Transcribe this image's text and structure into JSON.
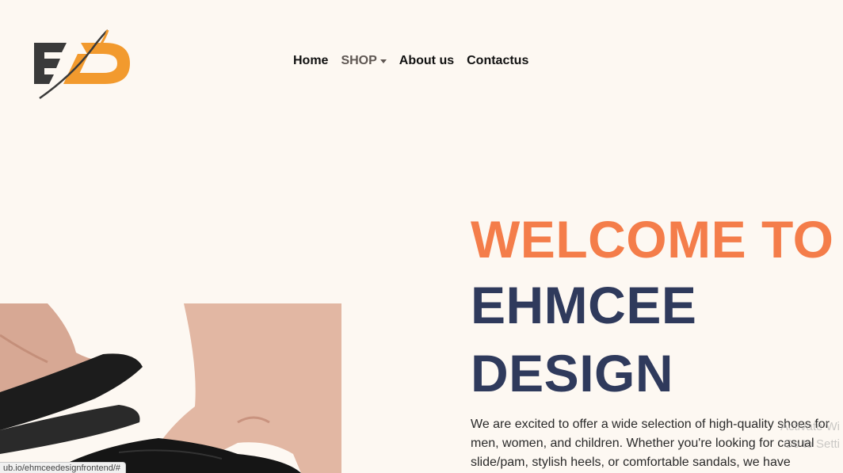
{
  "nav": {
    "home": "Home",
    "shop": "SHOP",
    "about": "About us",
    "contact": "Contactus"
  },
  "hero": {
    "welcome": "WELCOME TO",
    "brand_line1": "EHMCEE",
    "brand_line2": "DESIGN",
    "intro": "We are excited to offer a wide selection of high-quality shoes for men, women, and children. Whether you're looking for casual slide/pam, stylish heels, or comfortable sandals, we have something for"
  },
  "status_bar": {
    "url": "ub.io/ehmceedesignfrontend/#"
  },
  "watermark": {
    "line1": "Activate Wi",
    "line2": "Go to Setti"
  },
  "colors": {
    "background": "#fdf8f2",
    "accent_orange": "#f47d4a",
    "brand_navy": "#2f3a5c",
    "logo_dark": "#3a3a3a",
    "logo_orange": "#f29a2e"
  },
  "icons": {
    "logo": "ed-logo",
    "shop_caret": "caret-down-icon"
  }
}
